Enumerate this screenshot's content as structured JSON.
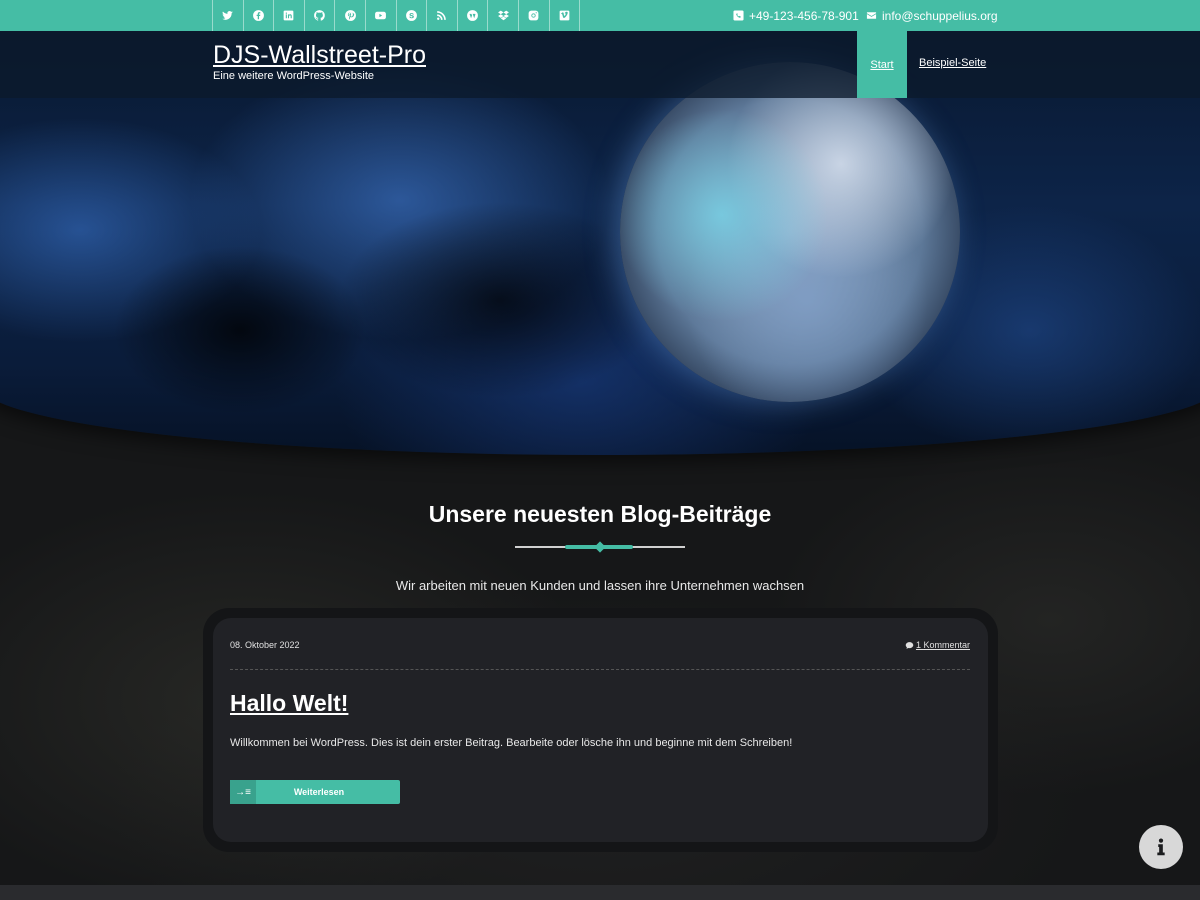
{
  "topbar": {
    "social_icons": [
      "twitter-icon",
      "facebook-icon",
      "linkedin-icon",
      "github-icon",
      "pinterest-icon",
      "youtube-icon",
      "skype-icon",
      "rss-icon",
      "wordpress-icon",
      "dropbox-icon",
      "instagram-icon",
      "vimeo-icon"
    ],
    "phone": "+49-123-456-78-901",
    "email": "info@schuppelius.org"
  },
  "header": {
    "site_title": "DJS-Wallstreet-Pro",
    "tagline": "Eine weitere WordPress-Website",
    "nav": [
      "Start",
      "Beispiel-Seite"
    ]
  },
  "section": {
    "title": "Unsere neuesten Blog-Beiträge",
    "subtitle": "Wir arbeiten mit neuen Kunden und lassen ihre Unternehmen wachsen"
  },
  "post": {
    "date": "08. Oktober 2022",
    "comments": "1 Kommentar",
    "title": "Hallo Welt!",
    "excerpt": "Willkommen bei WordPress. Dies ist dein erster Beitrag. Bearbeite oder lösche ihn und beginne mit dem Schreiben!",
    "read_more": "Weiterlesen",
    "read_more_icon": "→≡"
  },
  "colors": {
    "accent": "#45bda5",
    "background": "#1b1c1e"
  }
}
